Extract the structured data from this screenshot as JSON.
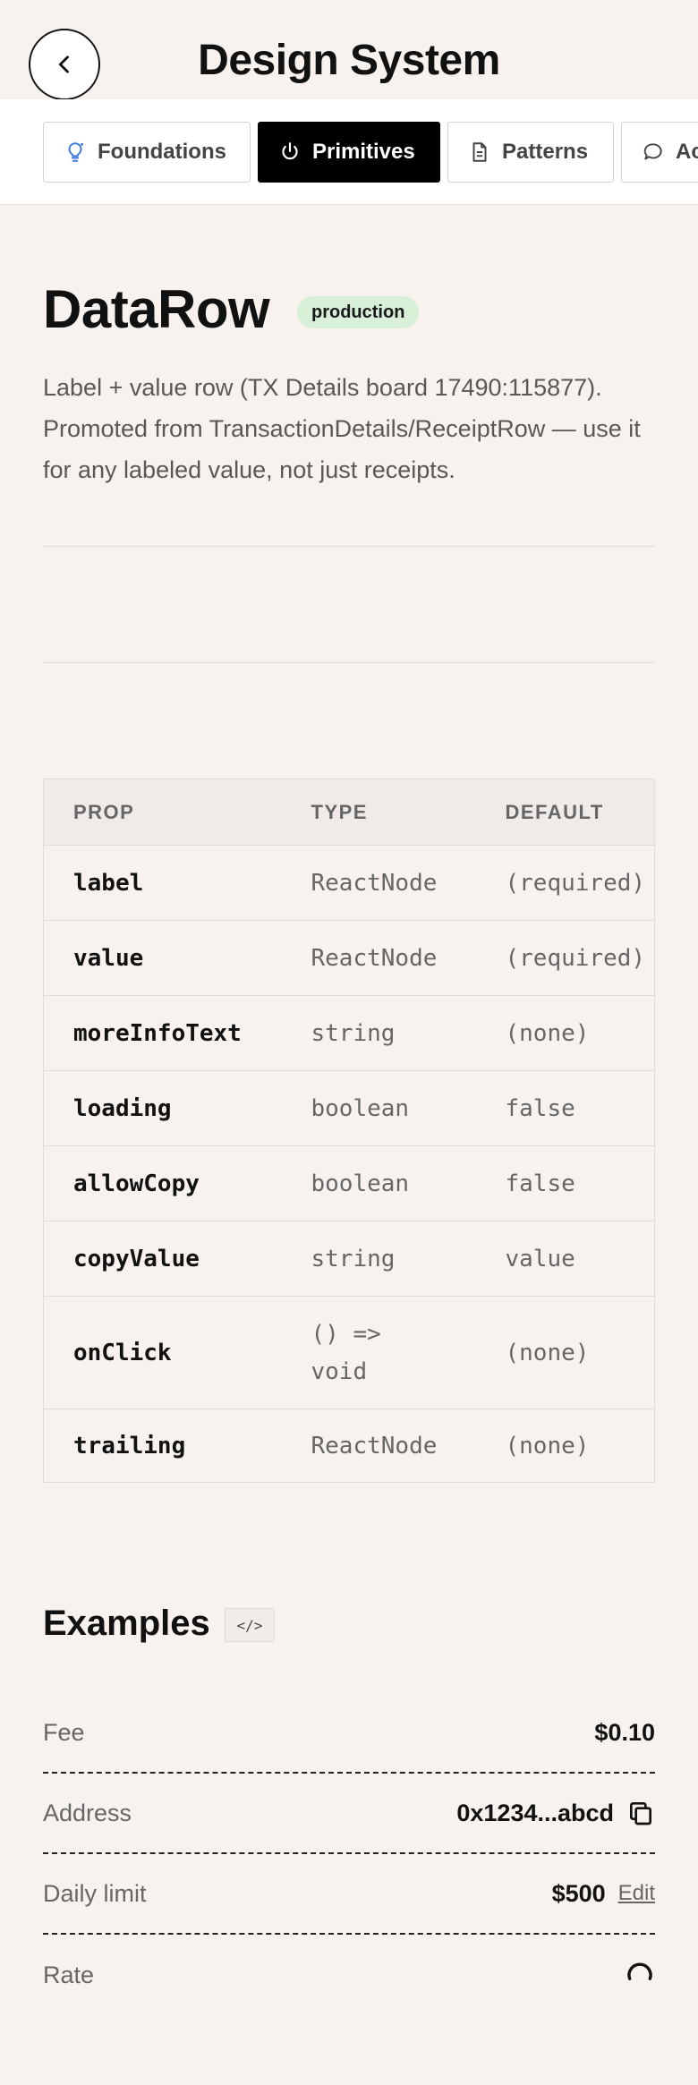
{
  "header": {
    "title": "Design System"
  },
  "tabs": [
    {
      "label": "Foundations",
      "icon": "lightbulb-icon"
    },
    {
      "label": "Primitives",
      "icon": "power-icon",
      "active": true
    },
    {
      "label": "Patterns",
      "icon": "document-icon"
    },
    {
      "label": "Ac",
      "icon": "chat-bubble-icon"
    }
  ],
  "component": {
    "name": "DataRow",
    "status": "production",
    "description": "Label + value row (TX Details board 17490:115877). Promoted from TransactionDetails/ReceiptRow — use it for any labeled value, not just receipts."
  },
  "props_table": {
    "headers": [
      "PROP",
      "TYPE",
      "DEFAULT"
    ],
    "rows": [
      {
        "prop": "label",
        "type": "ReactNode",
        "default": "(required)"
      },
      {
        "prop": "value",
        "type": "ReactNode",
        "default": "(required)"
      },
      {
        "prop": "moreInfoText",
        "type": "string",
        "default": "(none)"
      },
      {
        "prop": "loading",
        "type": "boolean",
        "default": "false"
      },
      {
        "prop": "allowCopy",
        "type": "boolean",
        "default": "false"
      },
      {
        "prop": "copyValue",
        "type": "string",
        "default": "value"
      },
      {
        "prop": "onClick",
        "type": "() =>\nvoid",
        "default": "(none)"
      },
      {
        "prop": "trailing",
        "type": "ReactNode",
        "default": "(none)"
      }
    ]
  },
  "examples": {
    "title": "Examples",
    "code_toggle": "</>",
    "rows": [
      {
        "label": "Fee",
        "value": "$0.10"
      },
      {
        "label": "Address",
        "value": "0x1234...abcd",
        "icon": "copy-icon"
      },
      {
        "label": "Daily limit",
        "value": "$500",
        "action": "Edit"
      },
      {
        "label": "Rate",
        "icon": "loading-spinner-icon"
      }
    ]
  },
  "colors": {
    "background": "#f7f2ee",
    "active_tab": "#000000",
    "badge_bg": "#d8efd8",
    "text_muted": "#666666"
  }
}
